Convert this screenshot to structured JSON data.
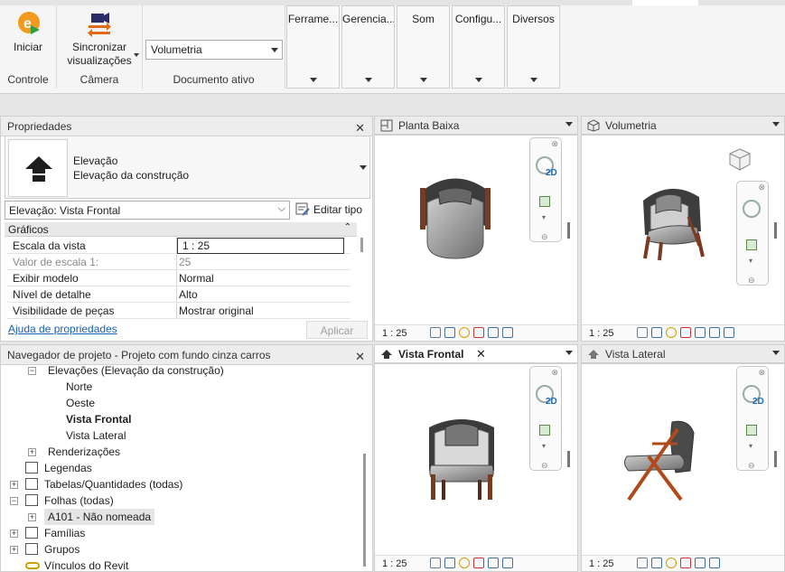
{
  "ribbon": {
    "controle": {
      "button": "Iniciar",
      "label": "Controle"
    },
    "camera": {
      "button_line1": "Sincronizar",
      "button_line2": "visualizações",
      "label": "Câmera"
    },
    "documento": {
      "selected": "Volumetria",
      "label": "Documento ativo"
    },
    "stubs": [
      "Ferrame...",
      "Gerencia...",
      "Som",
      "Configu...",
      "Diversos"
    ]
  },
  "properties": {
    "title": "Propriedades",
    "type_line1": "Elevação",
    "type_line2": "Elevação da construção",
    "selector": "Elevação: Vista Frontal",
    "edit_type": "Editar tipo",
    "section": "Gráficos",
    "rows": [
      {
        "key": "Escala da vista",
        "value": "1 : 25"
      },
      {
        "key": "Valor de escala    1:",
        "value": "25"
      },
      {
        "key": "Exibir modelo",
        "value": "Normal"
      },
      {
        "key": "Nível de detalhe",
        "value": "Alto"
      },
      {
        "key": "Visibilidade de peças",
        "value": "Mostrar original"
      }
    ],
    "help_link": "Ajuda de propriedades",
    "apply": "Aplicar"
  },
  "navigator": {
    "title": "Navegador de projeto - Projeto com fundo cinza carros",
    "items": [
      {
        "label": "Elevações (Elevação da construção)"
      },
      {
        "label": "Norte"
      },
      {
        "label": "Oeste"
      },
      {
        "label": "Vista Frontal"
      },
      {
        "label": "Vista Lateral"
      },
      {
        "label": "Renderizações"
      },
      {
        "label": "Legendas"
      },
      {
        "label": "Tabelas/Quantidades (todas)"
      },
      {
        "label": "Folhas (todas)"
      },
      {
        "label": "A101 - Não nomeada"
      },
      {
        "label": "Famílias"
      },
      {
        "label": "Grupos"
      },
      {
        "label": "Vínculos do Revit"
      }
    ]
  },
  "views": [
    {
      "title": "Planta Baixa",
      "scale": "1 : 25"
    },
    {
      "title": "Volumetria",
      "scale": "1 : 25"
    },
    {
      "title": "Vista Frontal",
      "scale": "1 : 25"
    },
    {
      "title": "Vista Lateral",
      "scale": "1 : 25"
    }
  ],
  "nav_label": "2D"
}
